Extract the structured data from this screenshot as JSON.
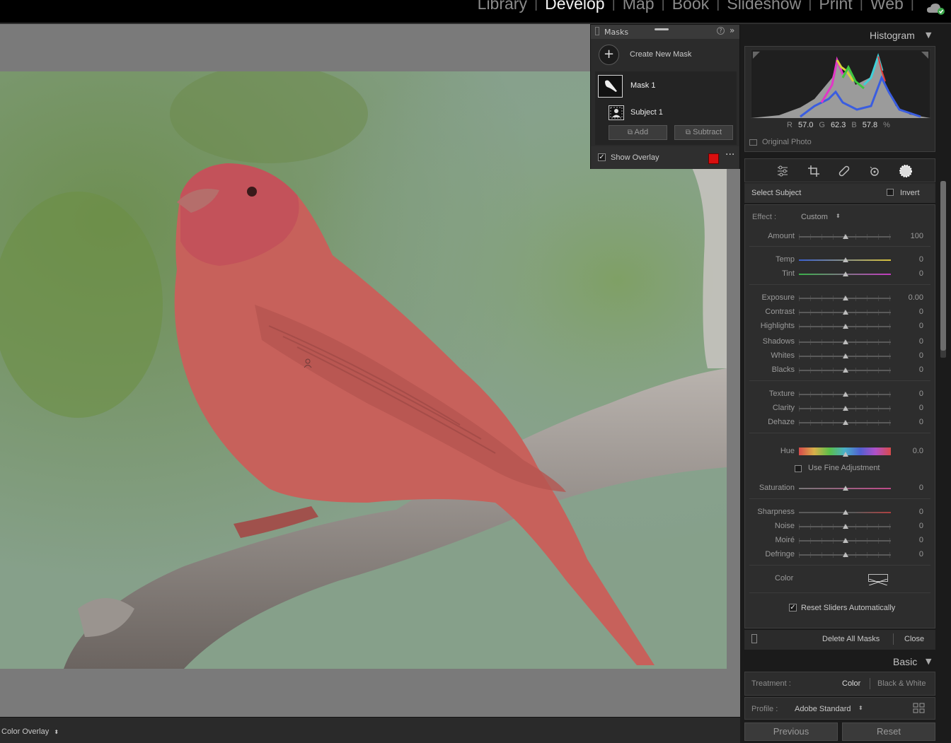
{
  "modules": [
    "Library",
    "Develop",
    "Map",
    "Book",
    "Slideshow",
    "Print",
    "Web"
  ],
  "active_module": "Develop",
  "toolbar": {
    "overlay_mode": "Color Overlay"
  },
  "masks": {
    "title": "Masks",
    "create_label": "Create New Mask",
    "mask_name": "Mask 1",
    "component_name": "Subject 1",
    "add_label": "Add",
    "subtract_label": "Subtract",
    "show_overlay_label": "Show Overlay",
    "show_overlay_checked": true,
    "overlay_color": "#d90f0f"
  },
  "histogram": {
    "title": "Histogram",
    "r_label": "R",
    "r_value": "57.0",
    "g_label": "G",
    "g_value": "62.3",
    "b_label": "B",
    "b_value": "57.8",
    "unit": "%",
    "original_photo_label": "Original Photo"
  },
  "tools": [
    "edit-sliders-icon",
    "crop-icon",
    "healing-icon",
    "red-eye-icon",
    "masking-icon"
  ],
  "mask_settings": {
    "select_subject_label": "Select Subject",
    "invert_label": "Invert",
    "effect_label": "Effect :",
    "effect_value": "Custom",
    "amount": {
      "label": "Amount",
      "value": "100"
    },
    "temp": {
      "label": "Temp",
      "value": "0"
    },
    "tint": {
      "label": "Tint",
      "value": "0"
    },
    "exposure": {
      "label": "Exposure",
      "value": "0.00"
    },
    "contrast": {
      "label": "Contrast",
      "value": "0"
    },
    "highlights": {
      "label": "Highlights",
      "value": "0"
    },
    "shadows": {
      "label": "Shadows",
      "value": "0"
    },
    "whites": {
      "label": "Whites",
      "value": "0"
    },
    "blacks": {
      "label": "Blacks",
      "value": "0"
    },
    "texture": {
      "label": "Texture",
      "value": "0"
    },
    "clarity": {
      "label": "Clarity",
      "value": "0"
    },
    "dehaze": {
      "label": "Dehaze",
      "value": "0"
    },
    "hue": {
      "label": "Hue",
      "value": "0.0"
    },
    "fine_adjust_label": "Use Fine Adjustment",
    "saturation": {
      "label": "Saturation",
      "value": "0"
    },
    "sharpness": {
      "label": "Sharpness",
      "value": "0"
    },
    "noise": {
      "label": "Noise",
      "value": "0"
    },
    "moire": {
      "label": "Moiré",
      "value": "0"
    },
    "defringe": {
      "label": "Defringe",
      "value": "0"
    },
    "color_label": "Color",
    "reset_auto_label": "Reset Sliders Automatically",
    "delete_all_label": "Delete All Masks",
    "close_label": "Close"
  },
  "basic": {
    "title": "Basic",
    "treatment_label": "Treatment :",
    "treatment_color": "Color",
    "treatment_bw": "Black & White",
    "profile_label": "Profile :",
    "profile_value": "Adobe Standard"
  },
  "footer": {
    "previous_label": "Previous",
    "reset_label": "Reset"
  }
}
